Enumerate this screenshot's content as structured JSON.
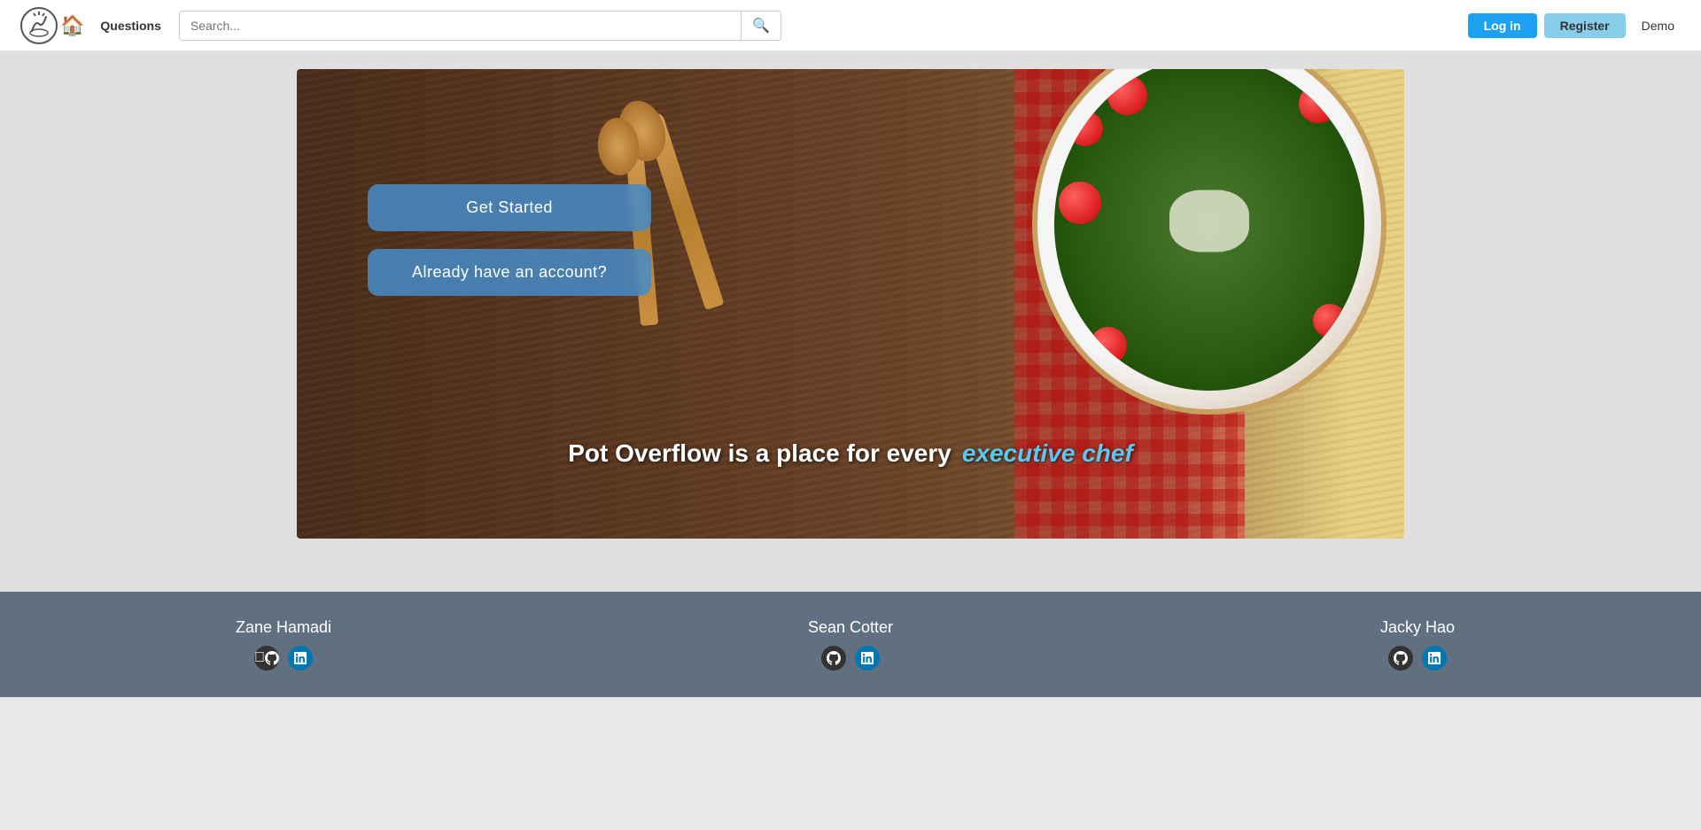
{
  "navbar": {
    "home_icon": "🏠",
    "questions_label": "Questions",
    "search_placeholder": "Search...",
    "search_icon": "🔍",
    "login_label": "Log in",
    "register_label": "Register",
    "demo_label": "Demo"
  },
  "hero": {
    "get_started_label": "Get Started",
    "account_label": "Already have an account?",
    "tagline_prefix": "Pot Overflow is a place for every",
    "tagline_suffix": "executive chef"
  },
  "footer": {
    "persons": [
      {
        "name": "Zane Hamadi",
        "github_title": "GitHub",
        "linkedin_title": "LinkedIn"
      },
      {
        "name": "Sean Cotter",
        "github_title": "GitHub",
        "linkedin_title": "LinkedIn"
      },
      {
        "name": "Jacky Hao",
        "github_title": "GitHub",
        "linkedin_title": "LinkedIn"
      }
    ]
  }
}
